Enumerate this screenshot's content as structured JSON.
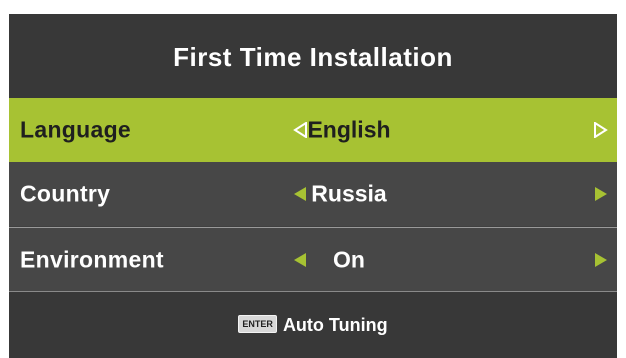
{
  "header": {
    "title": "First Time  Installation"
  },
  "settings": [
    {
      "label": "Language",
      "value": "English",
      "selected": true
    },
    {
      "label": "Country",
      "value": "Russia",
      "selected": false
    },
    {
      "label": "Environment",
      "value": "On",
      "selected": false
    }
  ],
  "footer": {
    "key_label": "ENTER",
    "action_label": "Auto Tuning"
  },
  "colors": {
    "selected_row": "#a7c233",
    "row_bg": "#474747",
    "arrow_active": "#a7c233",
    "arrow_on_selected": "#ffffff"
  },
  "icons": {
    "left": "left-arrow-icon",
    "right": "right-arrow-icon"
  }
}
